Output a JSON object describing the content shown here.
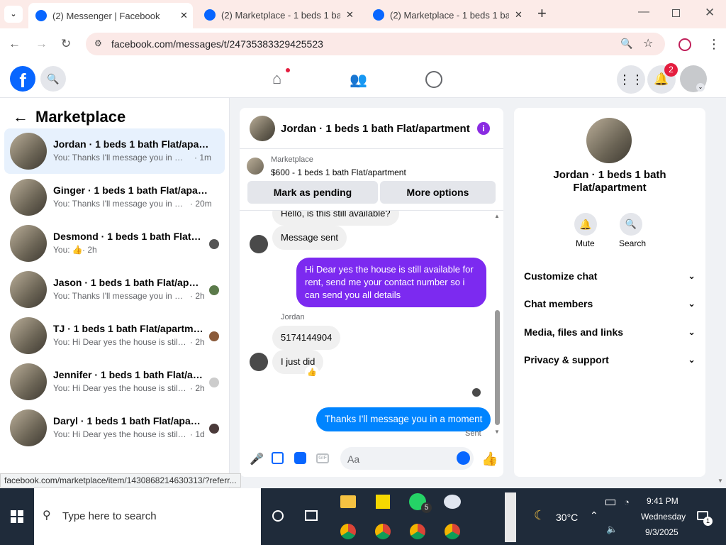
{
  "browser": {
    "tabs": [
      {
        "title": "(2) Messenger | Facebook"
      },
      {
        "title": "(2) Marketplace - 1 beds 1 bath"
      },
      {
        "title": "(2) Marketplace - 1 beds 1 bath"
      }
    ],
    "url": "facebook.com/messages/t/24735383329425523",
    "status_url": "facebook.com/marketplace/item/1430868214630313/?referr..."
  },
  "header": {
    "notification_count": "2"
  },
  "sidebar": {
    "title": "Marketplace",
    "conversations": [
      {
        "name": "Jordan · 1 beds 1 bath Flat/apartm...",
        "preview": "You: Thanks I'll message you in a mo...",
        "time": "· 1m"
      },
      {
        "name": "Ginger · 1 beds 1 bath Flat/apartm...",
        "preview": "You: Thanks I'll message you in a m...",
        "time": "· 20m"
      },
      {
        "name": "Desmond · 1 beds 1 bath Flat/ap...",
        "preview": "You: 👍",
        "time": "· 2h"
      },
      {
        "name": "Jason · 1 beds 1 bath Flat/apart...",
        "preview": "You: Thanks I'll message you in a m...",
        "time": "· 2h"
      },
      {
        "name": "TJ · 1 beds 1 bath Flat/apartment",
        "preview": "You: Hi Dear yes the house is still a...",
        "time": "· 2h"
      },
      {
        "name": "Jennifer · 1 beds 1 bath Flat/apar...",
        "preview": "You: Hi Dear yes the house is still a...",
        "time": "· 2h"
      },
      {
        "name": "Daryl · 1 beds 1 bath Flat/apart...",
        "preview": "You: Hi Dear yes the house is still a...",
        "time": "· 1d"
      }
    ]
  },
  "chat": {
    "title": "Jordan · 1 beds 1 bath Flat/apartment",
    "listing_source": "Marketplace",
    "listing": "$600 - 1 beds 1 bath Flat/apartment",
    "mark_pending": "Mark as pending",
    "more_options": "More options",
    "messages": {
      "m0": "Hello, is this still available?",
      "m1": "Message sent",
      "m2": "Hi Dear yes the house is still available for rent, send me your contact number so i can send you all details",
      "sender": "Jordan",
      "m3": "5174144904",
      "m4": "I just did",
      "m5": "Thanks I'll message you in a moment",
      "sent": "Sent"
    },
    "composer_placeholder": "Aa"
  },
  "details": {
    "name": "Jordan · 1 beds 1 bath Flat/apartment",
    "mute": "Mute",
    "search": "Search",
    "sections": [
      "Customize chat",
      "Chat members",
      "Media, files and links",
      "Privacy & support"
    ]
  },
  "taskbar": {
    "search_placeholder": "Type here to search",
    "whatsapp_badge": "5",
    "weather": "30°C",
    "time": "9:41 PM",
    "day": "Wednesday",
    "date": "9/3/2025",
    "notif_badge": "1"
  },
  "colors": {
    "fb_blue": "#0866ff",
    "bubble_blue": "#0084ff",
    "bubble_purple": "#7c2af0"
  }
}
